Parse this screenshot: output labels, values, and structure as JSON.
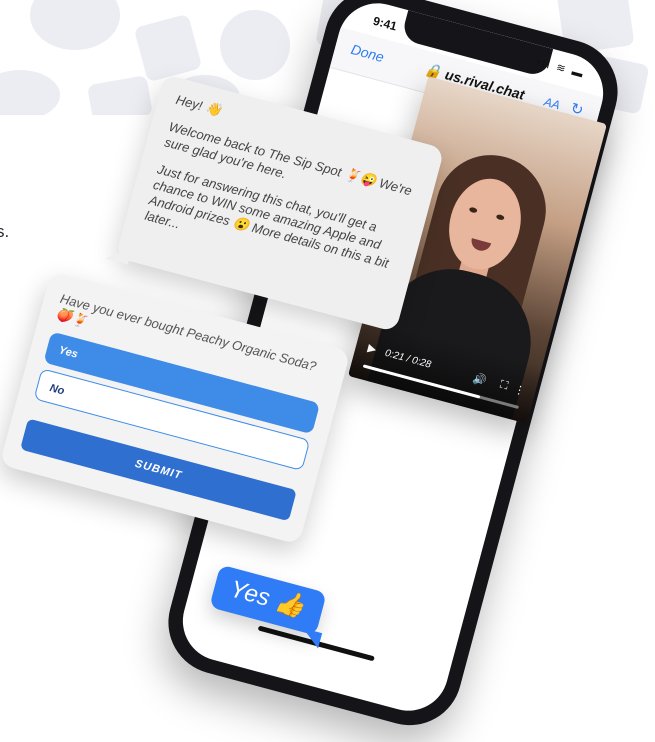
{
  "background_text": "s.",
  "phone": {
    "status_time": "9:41",
    "status_icons": "•ıl ≋ ▬",
    "done_label": "Done",
    "url": "🔒 us.rival.chat",
    "text_size_label": "AA",
    "reload_icon": "↻"
  },
  "message": {
    "greeting": "Hey! 👋",
    "welcome": "Welcome back to The Sip Spot 🍹😜 We're sure glad you're here.",
    "body": "Just for answering this chat, you'll get a chance to WIN some amazing Apple and Android prizes 😮 More details on this a bit later..."
  },
  "question": {
    "text": "Have you ever bought Peachy Organic Soda? 🍑🍹",
    "options": [
      "Yes",
      "No"
    ],
    "selected_option": "Yes",
    "submit_label": "SUBMIT"
  },
  "video": {
    "play_icon": "▶",
    "time": "0:21 / 0:28",
    "volume_icon": "🔊",
    "fullscreen_icon": "⛶",
    "more_icon": "⋮",
    "progress": 0.75
  },
  "reply": {
    "text": "Yes 👍"
  },
  "colors": {
    "accent": "#2f7cf6",
    "selected_option": "#3e8be8",
    "submit": "#2f6fd0"
  }
}
